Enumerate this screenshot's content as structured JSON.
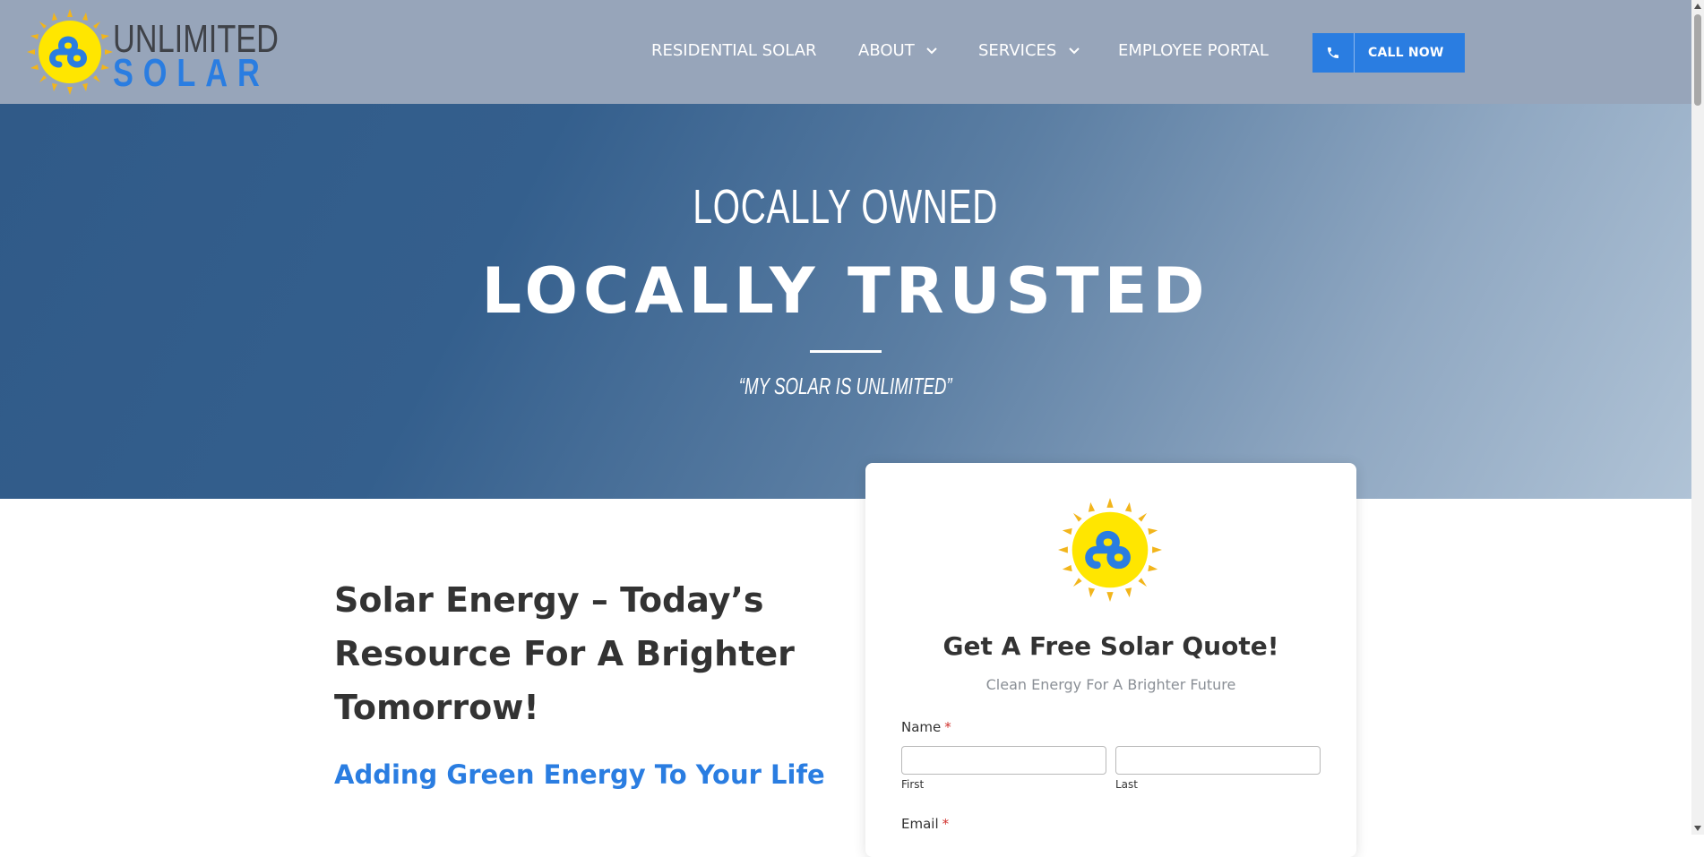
{
  "brand": {
    "name_top": "UNLIMITED",
    "name_bottom": "SOLAR",
    "colors": {
      "blue": "#2a7de1",
      "yellow": "#ffe600",
      "sun_ray": "#f2b51b",
      "header_bg": "#97a5ba"
    }
  },
  "nav": {
    "items": [
      {
        "label": "RESIDENTIAL SOLAR",
        "has_dropdown": false
      },
      {
        "label": "ABOUT",
        "has_dropdown": true
      },
      {
        "label": "SERVICES",
        "has_dropdown": true
      },
      {
        "label": "EMPLOYEE PORTAL",
        "has_dropdown": false
      }
    ],
    "call_button": {
      "label": "CALL NOW",
      "icon": "phone-icon"
    }
  },
  "hero": {
    "line1": "LOCALLY OWNED",
    "line2": "LOCALLY TRUSTED",
    "tagline": "“MY SOLAR IS UNLIMITED”"
  },
  "content": {
    "heading": "Solar Energy – Today’s Resource For A Brighter Tomorrow!",
    "subheading": "Adding Green Energy To Your Life"
  },
  "quote_form": {
    "title": "Get A Free Solar Quote!",
    "subtitle": "Clean Energy For A Brighter Future",
    "name_label": "Name",
    "required_mark": "*",
    "first_value": "",
    "first_label": "First",
    "last_value": "",
    "last_label": "Last",
    "email_label": "Email"
  }
}
